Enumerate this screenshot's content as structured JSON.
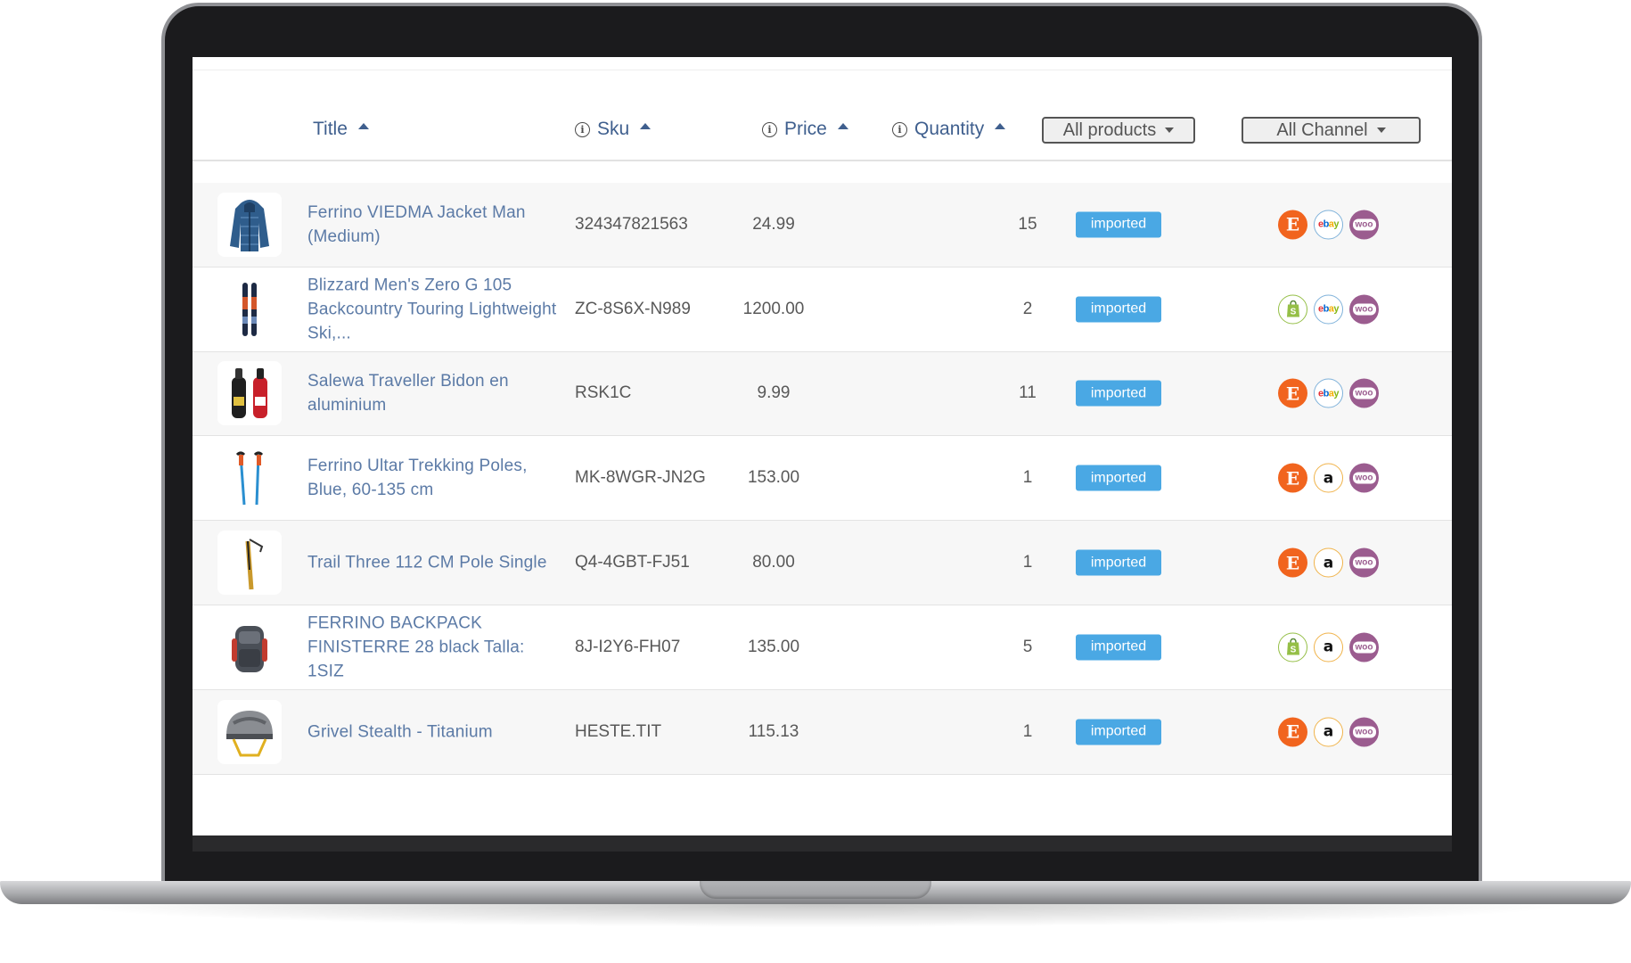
{
  "table": {
    "headers": {
      "title": "Title",
      "sku": "Sku",
      "price": "Price",
      "quantity": "Quantity"
    },
    "filters": {
      "products": "All products",
      "channel": "All Channel"
    },
    "rows": [
      {
        "title": "Ferrino VIEDMA Jacket Man (Medium)",
        "sku": "324347821563",
        "price": "24.99",
        "quantity": "15",
        "status": "imported",
        "channels": [
          "etsy-icon",
          "ebay-icon",
          "woocommerce-icon"
        ],
        "thumb": "jacket-image"
      },
      {
        "title": "Blizzard Men's Zero G 105 Backcountry Touring Lightweight Ski,...",
        "sku": "ZC-8S6X-N989",
        "price": "1200.00",
        "quantity": "2",
        "status": "imported",
        "channels": [
          "shopify-icon",
          "ebay-icon",
          "woocommerce-icon"
        ],
        "thumb": "skis-image"
      },
      {
        "title": "Salewa Traveller Bidon en aluminium",
        "sku": "RSK1C",
        "price": "9.99",
        "quantity": "11",
        "status": "imported",
        "channels": [
          "etsy-icon",
          "ebay-icon",
          "woocommerce-icon"
        ],
        "thumb": "bottles-image"
      },
      {
        "title": "Ferrino Ultar Trekking Poles, Blue, 60-135 cm",
        "sku": "MK-8WGR-JN2G",
        "price": "153.00",
        "quantity": "1",
        "status": "imported",
        "channels": [
          "etsy-icon",
          "amazon-icon",
          "woocommerce-icon"
        ],
        "thumb": "poles-image"
      },
      {
        "title": "Trail Three 112 CM Pole Single",
        "sku": "Q4-4GBT-FJ51",
        "price": "80.00",
        "quantity": "1",
        "status": "imported",
        "channels": [
          "etsy-icon",
          "amazon-icon",
          "woocommerce-icon"
        ],
        "thumb": "pole-image"
      },
      {
        "title": "FERRINO BACKPACK FINISTERRE 28 black Talla: 1SIZ",
        "sku": "8J-I2Y6-FH07",
        "price": "135.00",
        "quantity": "5",
        "status": "imported",
        "channels": [
          "shopify-icon",
          "amazon-icon",
          "woocommerce-icon"
        ],
        "thumb": "backpack-image"
      },
      {
        "title": "Grivel Stealth - Titanium",
        "sku": "HESTE.TIT",
        "price": "115.13",
        "quantity": "1",
        "status": "imported",
        "channels": [
          "etsy-icon",
          "amazon-icon",
          "woocommerce-icon"
        ],
        "thumb": "helmet-image"
      }
    ]
  },
  "icons": {
    "etsy_glyph": "E",
    "amazon_glyph": "a",
    "woo_glyph": "woo",
    "ebay_letters": [
      "e",
      "b",
      "a",
      "y"
    ],
    "info_glyph": "i"
  },
  "colors": {
    "status_badge": "#4aa8e4",
    "header_link": "#3f5f8e",
    "title_link": "#5b7aa6",
    "etsy": "#f1641e",
    "woocommerce": "#9b5c8f",
    "shopify": "#95bf47"
  }
}
